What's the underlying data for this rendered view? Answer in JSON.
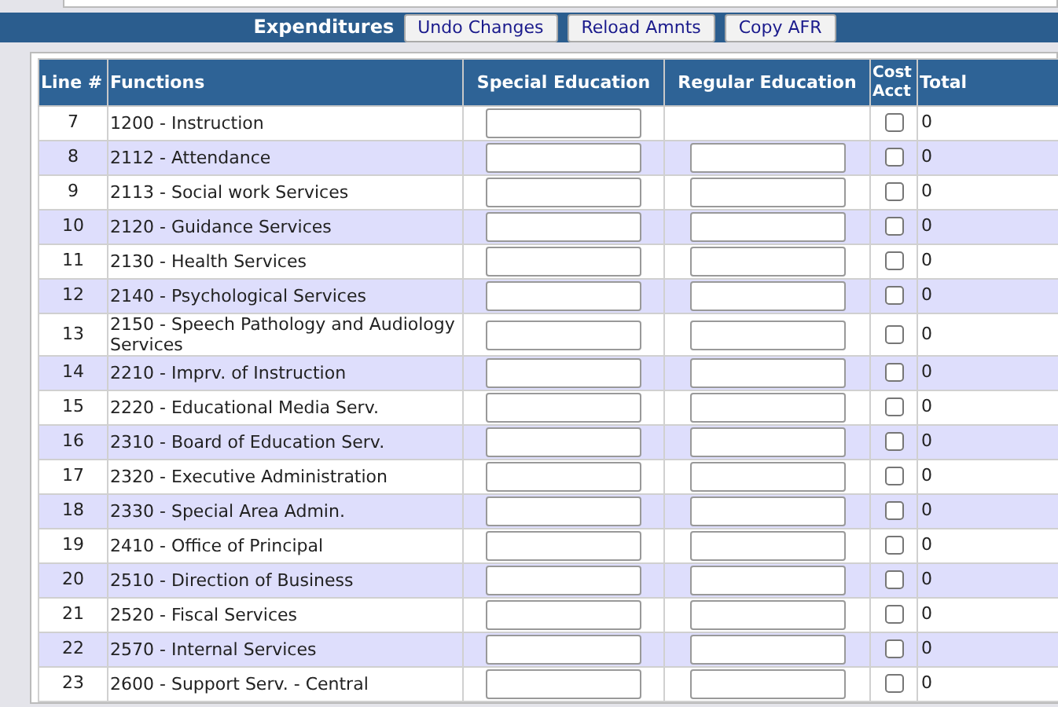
{
  "toolbar": {
    "title": "Expenditures",
    "buttons": [
      "Undo Changes",
      "Reload Amnts",
      "Copy AFR"
    ]
  },
  "table": {
    "columns": [
      "Line #",
      "Functions",
      "Special Education",
      "Regular Education",
      "Cost Acct",
      "Total"
    ],
    "rows": [
      {
        "line": "7",
        "function": "1200 - Instruction",
        "regular_field": false,
        "cost_acct_checked": false,
        "total": "0"
      },
      {
        "line": "8",
        "function": "2112 - Attendance",
        "regular_field": true,
        "cost_acct_checked": false,
        "total": "0"
      },
      {
        "line": "9",
        "function": "2113 - Social work Services",
        "regular_field": true,
        "cost_acct_checked": false,
        "total": "0"
      },
      {
        "line": "10",
        "function": "2120 - Guidance Services",
        "regular_field": true,
        "cost_acct_checked": false,
        "total": "0"
      },
      {
        "line": "11",
        "function": "2130 - Health Services",
        "regular_field": true,
        "cost_acct_checked": false,
        "total": "0"
      },
      {
        "line": "12",
        "function": "2140 - Psychological Services",
        "regular_field": true,
        "cost_acct_checked": false,
        "total": "0"
      },
      {
        "line": "13",
        "function": "2150 - Speech Pathology and Audiology Services",
        "regular_field": true,
        "cost_acct_checked": false,
        "total": "0"
      },
      {
        "line": "14",
        "function": "2210 - Imprv. of Instruction",
        "regular_field": true,
        "cost_acct_checked": false,
        "total": "0"
      },
      {
        "line": "15",
        "function": "2220 - Educational Media Serv.",
        "regular_field": true,
        "cost_acct_checked": false,
        "total": "0"
      },
      {
        "line": "16",
        "function": "2310 - Board of Education Serv.",
        "regular_field": true,
        "cost_acct_checked": false,
        "total": "0"
      },
      {
        "line": "17",
        "function": "2320 - Executive Administration",
        "regular_field": true,
        "cost_acct_checked": false,
        "total": "0"
      },
      {
        "line": "18",
        "function": "2330 - Special Area Admin.",
        "regular_field": true,
        "cost_acct_checked": false,
        "total": "0"
      },
      {
        "line": "19",
        "function": "2410 - Office of Principal",
        "regular_field": true,
        "cost_acct_checked": false,
        "total": "0"
      },
      {
        "line": "20",
        "function": "2510 - Direction of Business",
        "regular_field": true,
        "cost_acct_checked": false,
        "total": "0"
      },
      {
        "line": "21",
        "function": "2520 - Fiscal Services",
        "regular_field": true,
        "cost_acct_checked": false,
        "total": "0"
      },
      {
        "line": "22",
        "function": "2570 - Internal Services",
        "regular_field": true,
        "cost_acct_checked": false,
        "total": "0"
      },
      {
        "line": "23",
        "function": "2600 - Support Serv. - Central",
        "regular_field": true,
        "cost_acct_checked": false,
        "total": "0"
      }
    ]
  }
}
